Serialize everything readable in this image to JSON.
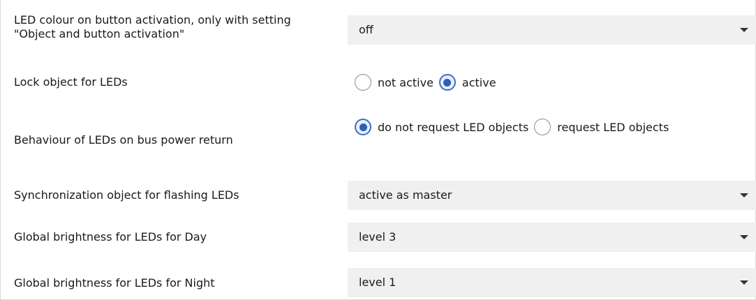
{
  "params": {
    "led_colour": {
      "label_line1": "LED colour on button activation, only with setting",
      "label_line2": "\"Object and button activation\"",
      "value": "off"
    },
    "lock_object": {
      "label": "Lock object for LEDs",
      "options": [
        "not active",
        "active"
      ],
      "selected": "active"
    },
    "bus_power_return": {
      "label": "Behaviour of LEDs on bus power return",
      "options": [
        "do not request LED objects",
        "request LED objects"
      ],
      "selected": "do not request LED objects"
    },
    "sync_object": {
      "label": "Synchronization object for flashing LEDs",
      "value": "active as master"
    },
    "brightness_day": {
      "label": "Global brightness for LEDs for Day",
      "value": "level 3"
    },
    "brightness_night": {
      "label": "Global brightness for LEDs for Night",
      "value": "level 1"
    }
  },
  "colors": {
    "dropdown_bg": "#f0f0f0",
    "radio_accent": "#2b5fb8"
  },
  "icons": {
    "dropdown_arrow": "chevron-down-icon",
    "radio": "radio-button-icon"
  }
}
